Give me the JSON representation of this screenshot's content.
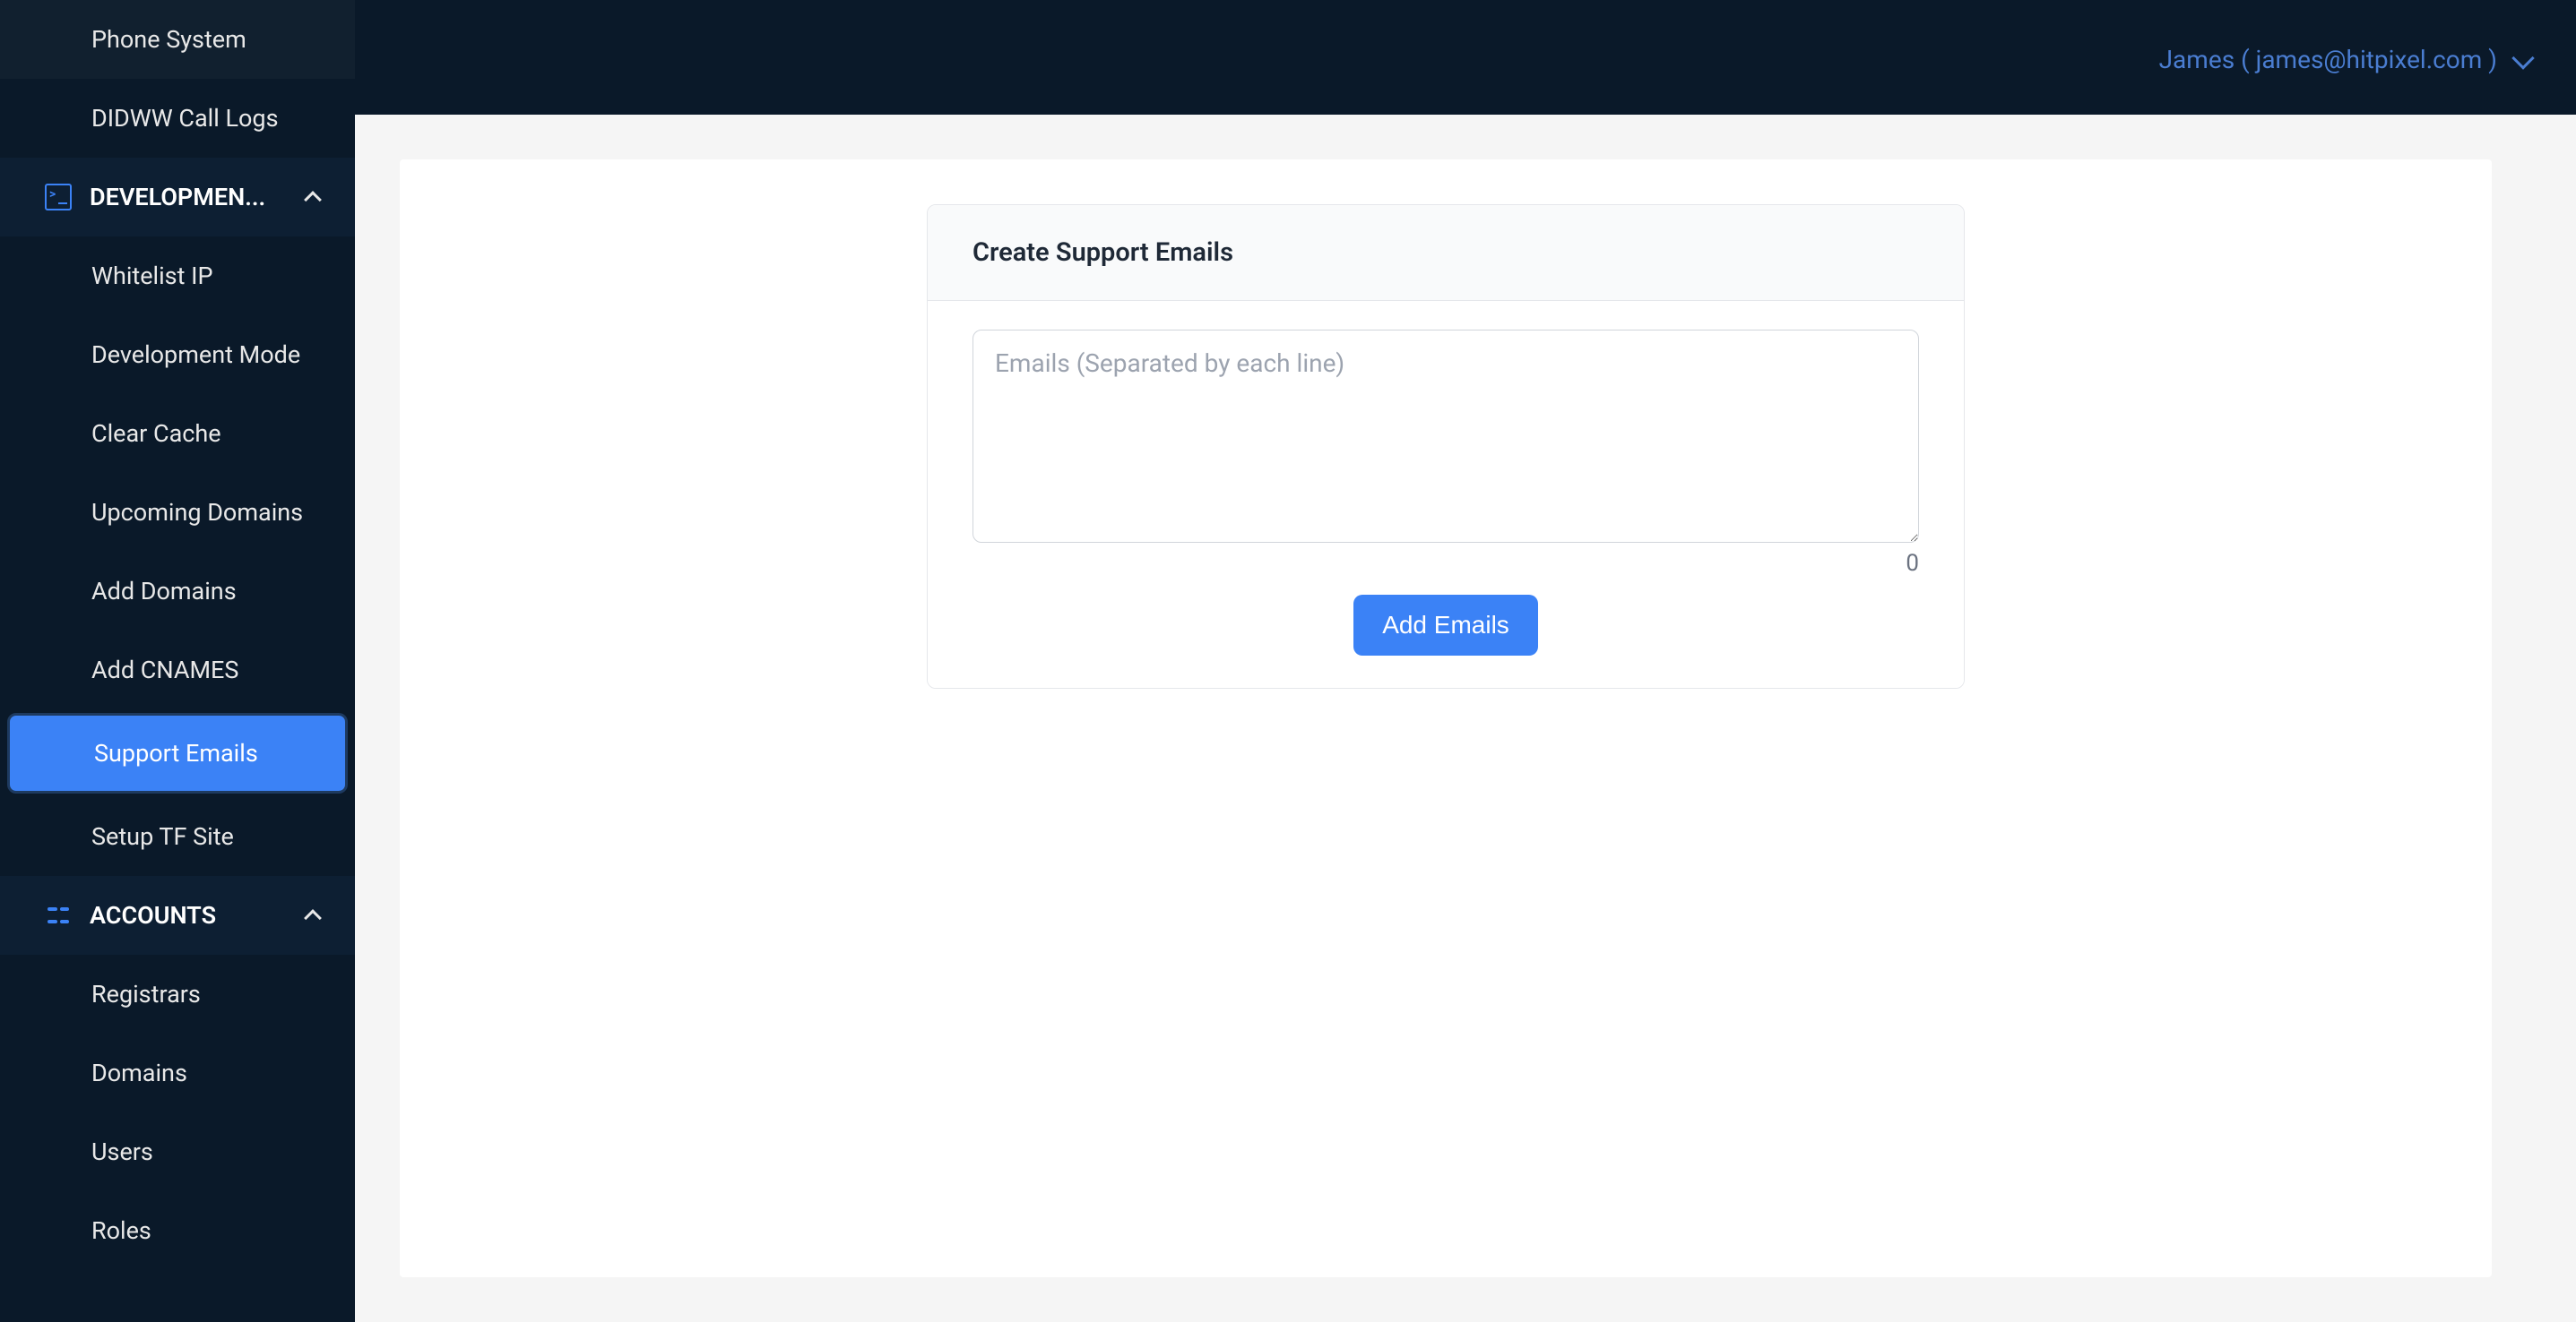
{
  "topbar": {
    "user_name": "James",
    "user_email": "james@hitpixel.com",
    "display": "James  (   james@hitpixel.com   )"
  },
  "sidebar": {
    "pre_items": [
      {
        "label": "Phone System"
      },
      {
        "label": "DIDWW Call Logs"
      }
    ],
    "sections": [
      {
        "label": "DEVELOPMEN...",
        "icon": "terminal",
        "expanded": true,
        "items": [
          {
            "label": "Whitelist IP"
          },
          {
            "label": "Development Mode"
          },
          {
            "label": "Clear Cache"
          },
          {
            "label": "Upcoming Domains"
          },
          {
            "label": "Add Domains"
          },
          {
            "label": "Add CNAMES"
          },
          {
            "label": "Support Emails",
            "active": true
          },
          {
            "label": "Setup TF Site"
          }
        ]
      },
      {
        "label": "ACCOUNTS",
        "icon": "grid",
        "expanded": true,
        "items": [
          {
            "label": "Registrars"
          },
          {
            "label": "Domains"
          },
          {
            "label": "Users"
          },
          {
            "label": "Roles"
          }
        ]
      }
    ]
  },
  "main": {
    "card_title": "Create Support Emails",
    "textarea_placeholder": "Emails (Separated by each line)",
    "textarea_value": "",
    "counter": "0",
    "submit_label": "Add Emails"
  }
}
